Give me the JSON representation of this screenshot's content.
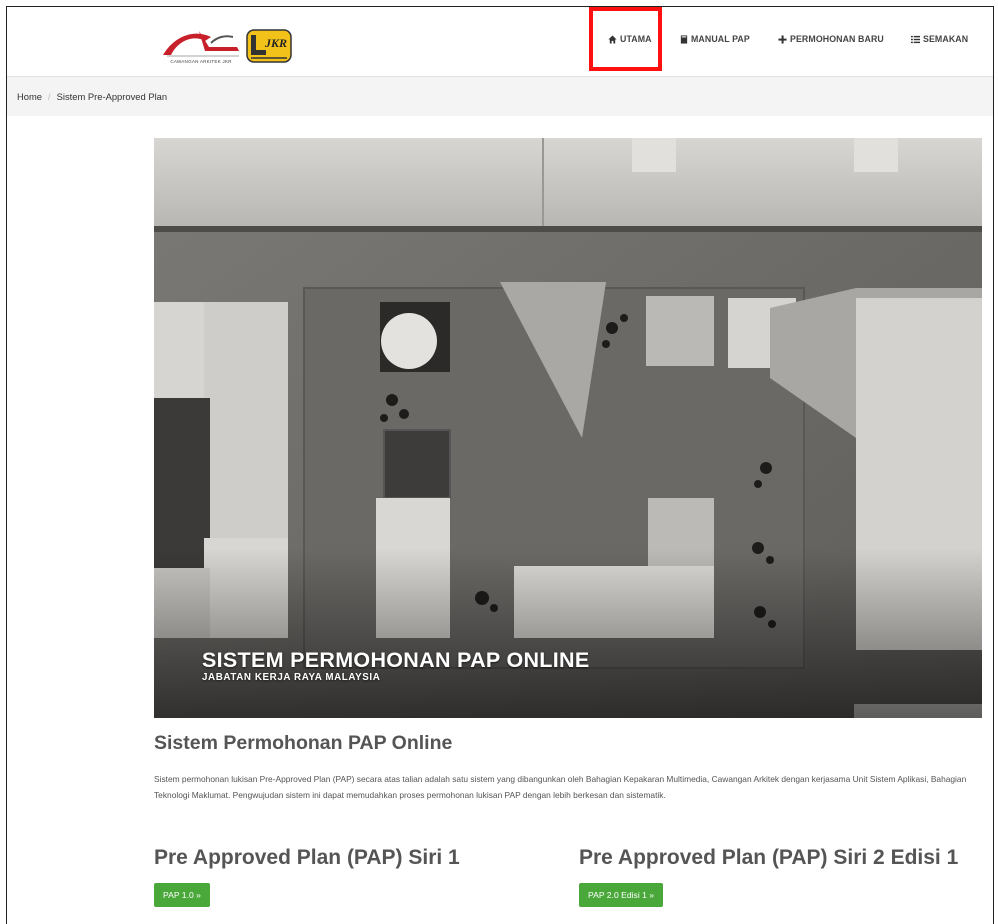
{
  "header": {
    "logo_arkitek_text": "CAWANGAN ARKITEK JKR",
    "logo_jkr_text": "JKR",
    "nav": [
      {
        "label": "UTAMA",
        "icon": "home-icon"
      },
      {
        "label": "MANUAL PAP",
        "icon": "book-icon"
      },
      {
        "label": "PERMOHONAN BARU",
        "icon": "plus-icon"
      },
      {
        "label": "SEMAKAN",
        "icon": "list-icon"
      }
    ],
    "highlight_color": "#ff1010"
  },
  "breadcrumb": {
    "home": "Home",
    "separator": "/",
    "current": "Sistem Pre-Approved Plan"
  },
  "hero": {
    "title": "SISTEM PERMOHONAN PAP ONLINE",
    "subtitle": "JABATAN KERJA RAYA MALAYSIA"
  },
  "main": {
    "title": "Sistem Permohonan PAP Online",
    "description": "Sistem permohonan lukisan Pre-Approved Plan (PAP) secara atas talian adalah satu sistem yang dibangunkan oleh Bahagian Kepakaran Multimedia, Cawangan Arkitek dengan kerjasama Unit Sistem Aplikasi, Bahagian Teknologi Maklumat. Pengwujudan sistem ini dapat memudahkan proses permohonan lukisan PAP dengan lebih berkesan dan sistematik."
  },
  "pap": [
    {
      "title": "Pre Approved Plan (PAP) Siri 1",
      "button": "PAP 1.0 »"
    },
    {
      "title": "Pre Approved Plan (PAP) Siri 2 Edisi 1",
      "button": "PAP 2.0 Edisi 1 »"
    }
  ],
  "colors": {
    "button_green": "#4aa83b",
    "breadcrumb_bg": "#f4f4f4",
    "logo_red": "#c8202a",
    "jkr_yellow": "#f2c21b"
  }
}
